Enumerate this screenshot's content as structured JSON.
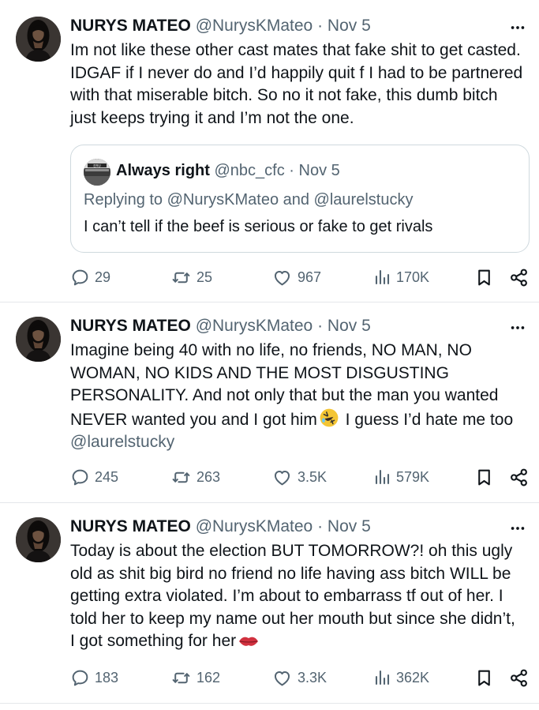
{
  "tweets": [
    {
      "name": "NURYS MATEO",
      "handle": "@NurysKMateo",
      "separator": "·",
      "date": "Nov 5",
      "text": "Im not like these other cast mates that fake shit to get casted. IDGAF if I never do and I’d happily quit f I had to be partnered with that miserable bitch. So no it not fake, this dumb bitch just keeps trying it and I’m not the one.",
      "quote": {
        "name": "Always right",
        "handle": "@nbc_cfc",
        "separator": "·",
        "date": "Nov 5",
        "reply_line": "Replying to @NurysKMateo and @laurelstucky",
        "text": "I can’t tell if the beef is serious or fake to get rivals"
      },
      "stats": {
        "replies": "29",
        "reposts": "25",
        "likes": "967",
        "views": "170K"
      }
    },
    {
      "name": "NURYS MATEO",
      "handle": "@NurysKMateo",
      "separator": "·",
      "date": "Nov 5",
      "text_before_emoji": "Imagine being 40 with no life, no friends, NO MAN, NO WOMAN, NO KIDS AND THE MOST DISGUSTING PERSONALITY. And not only that but the man you wanted NEVER wanted you and I got him",
      "emoji": "rolling-on-floor-laughing-emoji",
      "text_after_emoji": " I guess I’d hate me too",
      "mention": "@laurelstucky",
      "stats": {
        "replies": "245",
        "reposts": "263",
        "likes": "3.5K",
        "views": "579K"
      }
    },
    {
      "name": "NURYS MATEO",
      "handle": "@NurysKMateo",
      "separator": "·",
      "date": "Nov 5",
      "text_before_emoji": "Today is about the election BUT TOMORROW?! oh this ugly old as shit big bird no friend no life having ass bitch WILL be getting extra violated. I’m about to embarrass tf out of her. I told her to keep my name out her mouth but since she didn’t, I got something for her",
      "emoji": "kiss-mark-emoji",
      "stats": {
        "replies": "183",
        "reposts": "162",
        "likes": "3.3K",
        "views": "362K"
      }
    }
  ],
  "icons": {
    "more": "more-horizontal-icon",
    "reply": "reply-bubble-icon",
    "repost": "repost-icon",
    "like": "heart-icon",
    "views": "views-bar-chart-icon",
    "bookmark": "bookmark-icon",
    "share": "share-icon"
  },
  "colors": {
    "text": "#0f1419",
    "secondary": "#536471",
    "border": "#cfd9de",
    "divider": "#e4e7ea"
  }
}
